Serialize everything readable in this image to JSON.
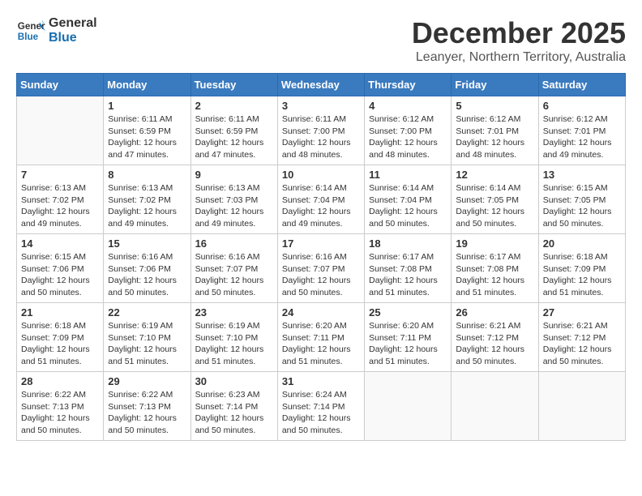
{
  "logo": {
    "general": "General",
    "blue": "Blue"
  },
  "title": {
    "month": "December 2025",
    "location": "Leanyer, Northern Territory, Australia"
  },
  "days_of_week": [
    "Sunday",
    "Monday",
    "Tuesday",
    "Wednesday",
    "Thursday",
    "Friday",
    "Saturday"
  ],
  "weeks": [
    [
      {
        "day": "",
        "content": ""
      },
      {
        "day": "1",
        "content": "Sunrise: 6:11 AM\nSunset: 6:59 PM\nDaylight: 12 hours\nand 47 minutes."
      },
      {
        "day": "2",
        "content": "Sunrise: 6:11 AM\nSunset: 6:59 PM\nDaylight: 12 hours\nand 47 minutes."
      },
      {
        "day": "3",
        "content": "Sunrise: 6:11 AM\nSunset: 7:00 PM\nDaylight: 12 hours\nand 48 minutes."
      },
      {
        "day": "4",
        "content": "Sunrise: 6:12 AM\nSunset: 7:00 PM\nDaylight: 12 hours\nand 48 minutes."
      },
      {
        "day": "5",
        "content": "Sunrise: 6:12 AM\nSunset: 7:01 PM\nDaylight: 12 hours\nand 48 minutes."
      },
      {
        "day": "6",
        "content": "Sunrise: 6:12 AM\nSunset: 7:01 PM\nDaylight: 12 hours\nand 49 minutes."
      }
    ],
    [
      {
        "day": "7",
        "content": "Sunrise: 6:13 AM\nSunset: 7:02 PM\nDaylight: 12 hours\nand 49 minutes."
      },
      {
        "day": "8",
        "content": "Sunrise: 6:13 AM\nSunset: 7:02 PM\nDaylight: 12 hours\nand 49 minutes."
      },
      {
        "day": "9",
        "content": "Sunrise: 6:13 AM\nSunset: 7:03 PM\nDaylight: 12 hours\nand 49 minutes."
      },
      {
        "day": "10",
        "content": "Sunrise: 6:14 AM\nSunset: 7:04 PM\nDaylight: 12 hours\nand 49 minutes."
      },
      {
        "day": "11",
        "content": "Sunrise: 6:14 AM\nSunset: 7:04 PM\nDaylight: 12 hours\nand 50 minutes."
      },
      {
        "day": "12",
        "content": "Sunrise: 6:14 AM\nSunset: 7:05 PM\nDaylight: 12 hours\nand 50 minutes."
      },
      {
        "day": "13",
        "content": "Sunrise: 6:15 AM\nSunset: 7:05 PM\nDaylight: 12 hours\nand 50 minutes."
      }
    ],
    [
      {
        "day": "14",
        "content": "Sunrise: 6:15 AM\nSunset: 7:06 PM\nDaylight: 12 hours\nand 50 minutes."
      },
      {
        "day": "15",
        "content": "Sunrise: 6:16 AM\nSunset: 7:06 PM\nDaylight: 12 hours\nand 50 minutes."
      },
      {
        "day": "16",
        "content": "Sunrise: 6:16 AM\nSunset: 7:07 PM\nDaylight: 12 hours\nand 50 minutes."
      },
      {
        "day": "17",
        "content": "Sunrise: 6:16 AM\nSunset: 7:07 PM\nDaylight: 12 hours\nand 50 minutes."
      },
      {
        "day": "18",
        "content": "Sunrise: 6:17 AM\nSunset: 7:08 PM\nDaylight: 12 hours\nand 51 minutes."
      },
      {
        "day": "19",
        "content": "Sunrise: 6:17 AM\nSunset: 7:08 PM\nDaylight: 12 hours\nand 51 minutes."
      },
      {
        "day": "20",
        "content": "Sunrise: 6:18 AM\nSunset: 7:09 PM\nDaylight: 12 hours\nand 51 minutes."
      }
    ],
    [
      {
        "day": "21",
        "content": "Sunrise: 6:18 AM\nSunset: 7:09 PM\nDaylight: 12 hours\nand 51 minutes."
      },
      {
        "day": "22",
        "content": "Sunrise: 6:19 AM\nSunset: 7:10 PM\nDaylight: 12 hours\nand 51 minutes."
      },
      {
        "day": "23",
        "content": "Sunrise: 6:19 AM\nSunset: 7:10 PM\nDaylight: 12 hours\nand 51 minutes."
      },
      {
        "day": "24",
        "content": "Sunrise: 6:20 AM\nSunset: 7:11 PM\nDaylight: 12 hours\nand 51 minutes."
      },
      {
        "day": "25",
        "content": "Sunrise: 6:20 AM\nSunset: 7:11 PM\nDaylight: 12 hours\nand 51 minutes."
      },
      {
        "day": "26",
        "content": "Sunrise: 6:21 AM\nSunset: 7:12 PM\nDaylight: 12 hours\nand 50 minutes."
      },
      {
        "day": "27",
        "content": "Sunrise: 6:21 AM\nSunset: 7:12 PM\nDaylight: 12 hours\nand 50 minutes."
      }
    ],
    [
      {
        "day": "28",
        "content": "Sunrise: 6:22 AM\nSunset: 7:13 PM\nDaylight: 12 hours\nand 50 minutes."
      },
      {
        "day": "29",
        "content": "Sunrise: 6:22 AM\nSunset: 7:13 PM\nDaylight: 12 hours\nand 50 minutes."
      },
      {
        "day": "30",
        "content": "Sunrise: 6:23 AM\nSunset: 7:14 PM\nDaylight: 12 hours\nand 50 minutes."
      },
      {
        "day": "31",
        "content": "Sunrise: 6:24 AM\nSunset: 7:14 PM\nDaylight: 12 hours\nand 50 minutes."
      },
      {
        "day": "",
        "content": ""
      },
      {
        "day": "",
        "content": ""
      },
      {
        "day": "",
        "content": ""
      }
    ]
  ]
}
